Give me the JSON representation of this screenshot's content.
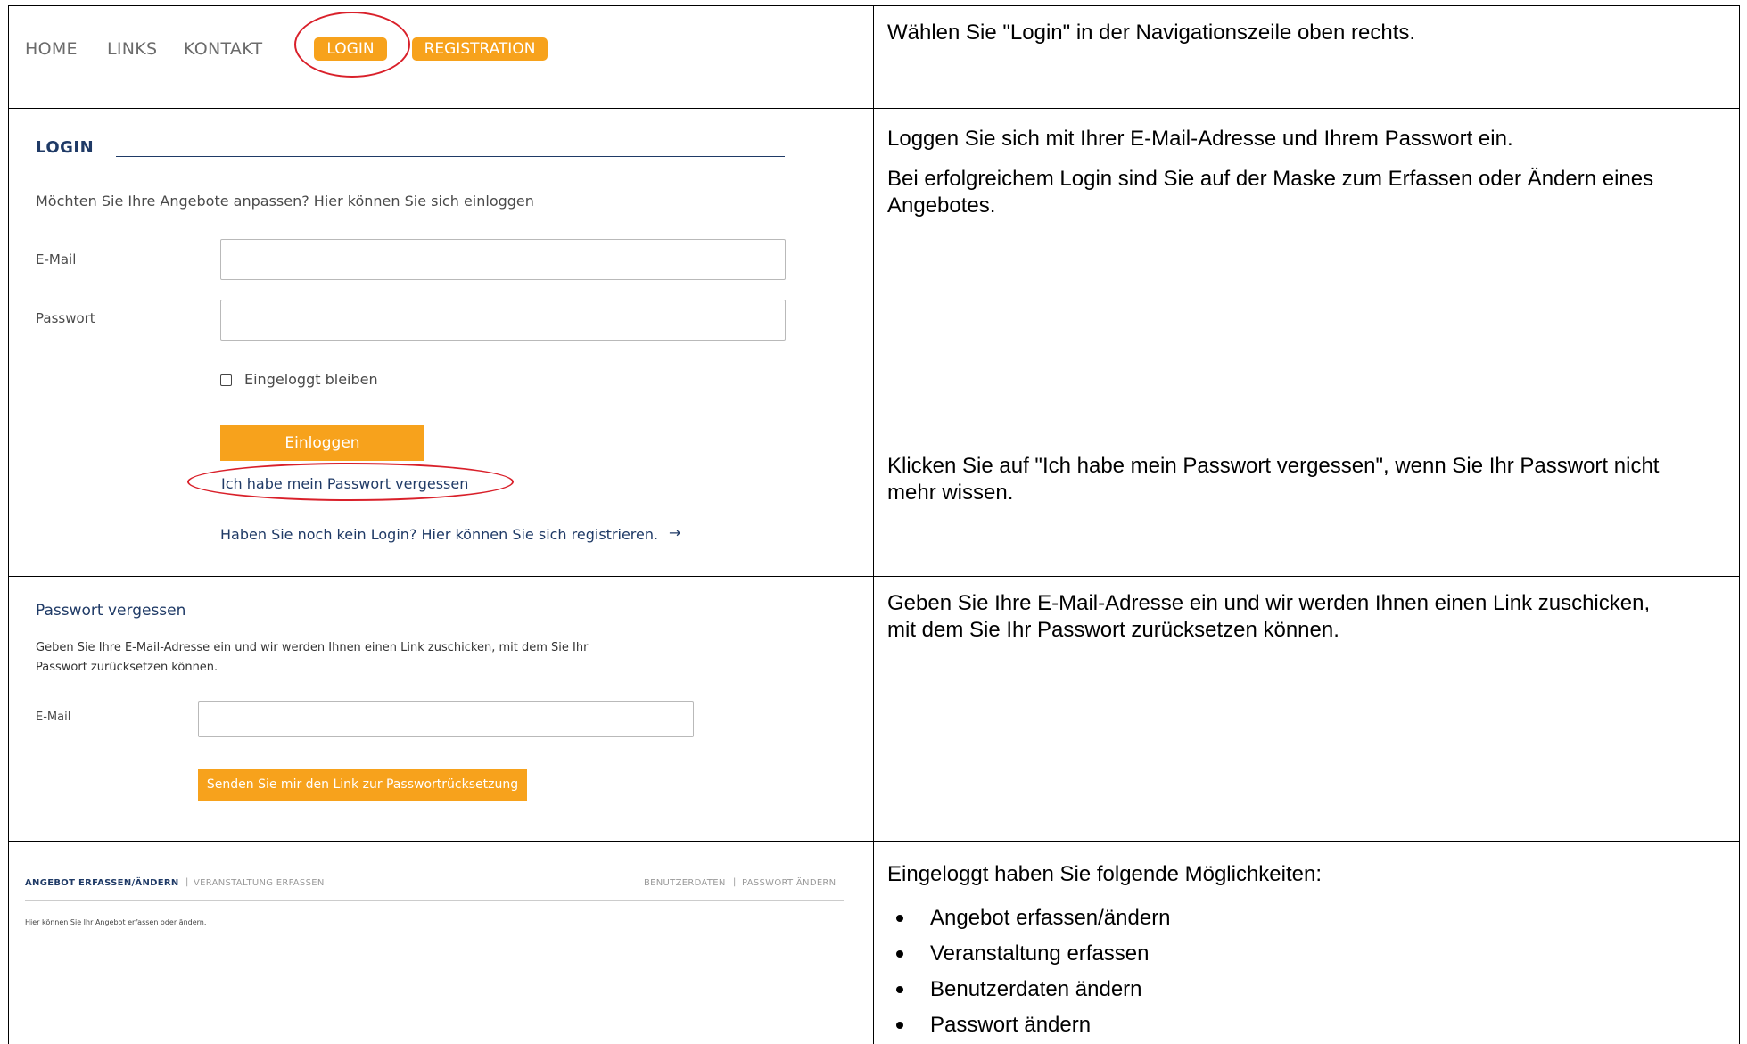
{
  "row1": {
    "nav": {
      "home": "HOME",
      "links": "LINKS",
      "kontakt": "KONTAKT",
      "login": "LOGIN",
      "registration": "REGISTRATION"
    },
    "instruction": "Wählen Sie \"Login\" in der Navigationszeile oben rechts."
  },
  "row2": {
    "heading": "LOGIN",
    "intro": "Möchten Sie Ihre Angebote anpassen? Hier können Sie sich einloggen",
    "email_label": "E-Mail",
    "password_label": "Passwort",
    "remember_label": "Eingeloggt bleiben",
    "login_button": "Einloggen",
    "forgot_link": "Ich habe mein Passwort vergessen",
    "register_link": "Haben Sie noch kein Login? Hier können Sie sich registrieren.",
    "arrow": "→",
    "instruction_1": "Loggen Sie sich mit Ihrer E-Mail-Adresse und Ihrem Passwort ein.",
    "instruction_2": "Bei erfolgreichem Login sind Sie auf der Maske zum Erfassen oder Ändern eines Angebotes.",
    "instruction_3": "Klicken Sie auf \"Ich habe mein Passwort vergessen\", wenn Sie Ihr Passwort nicht mehr wissen."
  },
  "row3": {
    "heading": "Passwort vergessen",
    "intro_line1": "Geben Sie Ihre E-Mail-Adresse ein und wir werden Ihnen einen Link zuschicken, mit dem Sie Ihr",
    "intro_line2": "Passwort zurücksetzen können.",
    "email_label": "E-Mail",
    "send_button": "Senden Sie mir den Link zur Passwortrücksetzung",
    "instruction": "Geben Sie Ihre E-Mail-Adresse ein und wir werden Ihnen einen Link zuschicken, mit dem Sie Ihr Passwort zurücksetzen können."
  },
  "row4": {
    "menu_left_1": "ANGEBOT ERFASSEN/ÄNDERN",
    "menu_sep": "|",
    "menu_left_2": "VERANSTALTUNG ERFASSEN",
    "menu_right_1": "BENUTZERDATEN",
    "menu_right_2": "PASSWORT ÄNDERN",
    "note": "Hier können Sie Ihr Angebot erfassen oder ändern.",
    "instruction": "Eingeloggt haben Sie folgende Möglichkeiten:",
    "bullets": [
      "Angebot erfassen/ändern",
      "Veranstaltung erfassen",
      "Benutzerdaten ändern",
      "Passwort ändern"
    ]
  },
  "colors": {
    "orange": "#f7a21c",
    "navy": "#1f3a66",
    "annotation_red": "#d9202a"
  }
}
